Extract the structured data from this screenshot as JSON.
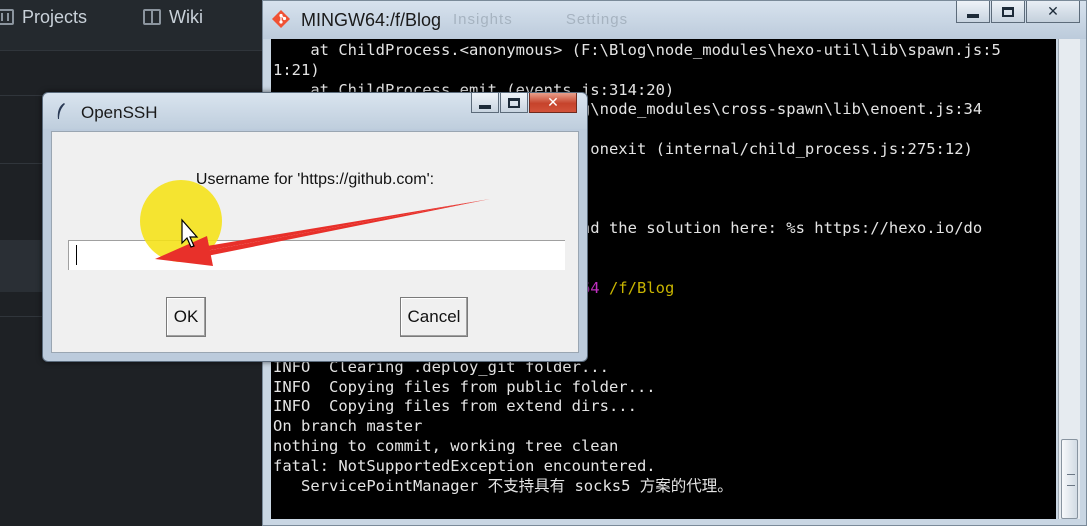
{
  "background_app": {
    "nav": [
      {
        "label": "Projects",
        "icon": "project-board-icon"
      },
      {
        "label": "Wiki",
        "icon": "book-icon"
      }
    ]
  },
  "terminal": {
    "title": "MINGW64:/f/Blog",
    "ghost_tabs": [
      "Insights",
      "Settings"
    ],
    "lines": [
      [
        {
          "t": "    at ChildProcess.<anonymous> (F:\\Blog\\node_modules\\hexo-util\\lib\\spawn.js:5"
        }
      ],
      [
        {
          "t": "1:21)"
        }
      ],
      [
        {
          "t": "    at ChildProcess.emit (events.js:314:20)"
        }
      ],
      [
        {
          "t": "                            :\\Blog\\node_modules\\cross-spawn\\lib\\enoent.js:34"
        }
      ],
      [
        {
          "t": ""
        }
      ],
      [
        {
          "t": "                            andle.onexit (internal/child_process.js:275:12)"
        }
      ],
      [
        {
          "t": ""
        }
      ],
      [
        {
          "t": ""
        }
      ],
      [
        {
          "t": ""
        }
      ],
      [
        {
          "t": "                            an find the solution here: %s https://hexo.io/do"
        }
      ],
      [
        {
          "t": ""
        }
      ],
      [
        {
          "t": ""
        }
      ],
      [
        {
          "t": "                            ",
          "c": ""
        },
        {
          "t": "MINGW64",
          "c": "t-magenta"
        },
        {
          "t": " "
        },
        {
          "t": "/f/Blog",
          "c": "t-yellow"
        }
      ],
      [
        {
          "t": ""
        }
      ],
      [
        {
          "t": ""
        }
      ],
      [
        {
          "t": ""
        }
      ],
      [
        {
          "t": "INFO  Clearing .deploy_git folder..."
        }
      ],
      [
        {
          "t": "INFO  Copying files from public folder..."
        }
      ],
      [
        {
          "t": "INFO  Copying files from extend dirs..."
        }
      ],
      [
        {
          "t": "On branch master"
        }
      ],
      [
        {
          "t": "nothing to commit, working tree clean"
        }
      ],
      [
        {
          "t": "fatal: NotSupportedException encountered."
        }
      ],
      [
        {
          "t": "   ServicePointManager 不支持具有 socks5 方案的代理。"
        }
      ]
    ]
  },
  "dialog": {
    "title": "OpenSSH",
    "prompt": "Username for 'https://github.com':",
    "username_value": "",
    "ok_label": "OK",
    "cancel_label": "Cancel"
  },
  "window_controls": {
    "minimize": "minimize-icon",
    "maximize": "maximize-icon",
    "close_glyph": "✕"
  },
  "colors": {
    "terminal_bg": "#000000",
    "terminal_fg": "#e4e4e4",
    "prompt_host": "#c030c0",
    "prompt_path": "#c8b400",
    "highlight": "#f5e114",
    "arrow": "#e8302a"
  }
}
